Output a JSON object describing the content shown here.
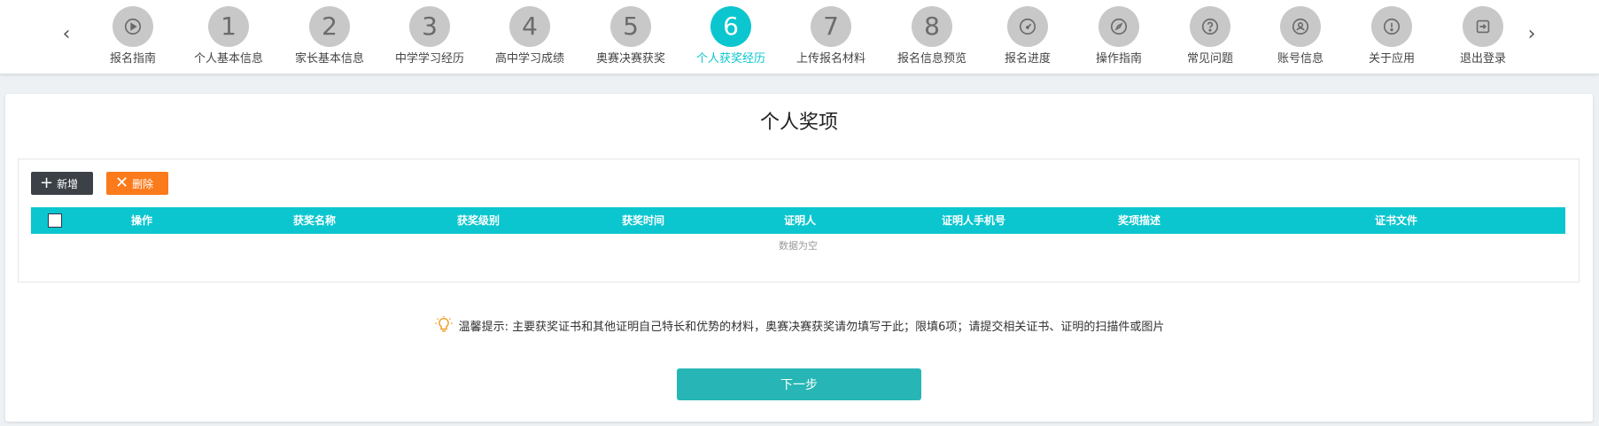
{
  "nav": {
    "prev_arrow": "‹",
    "next_arrow": "›",
    "steps": [
      {
        "label": "报名指南",
        "icon": "play-circle-icon"
      },
      {
        "label": "个人基本信息",
        "num": "1"
      },
      {
        "label": "家长基本信息",
        "num": "2"
      },
      {
        "label": "中学学习经历",
        "num": "3"
      },
      {
        "label": "高中学习成绩",
        "num": "4"
      },
      {
        "label": "奥赛决赛获奖",
        "num": "5"
      },
      {
        "label": "个人获奖经历",
        "num": "6",
        "active": true
      },
      {
        "label": "上传报名材料",
        "num": "7"
      },
      {
        "label": "报名信息预览",
        "num": "8"
      },
      {
        "label": "报名进度",
        "icon": "gauge-icon"
      },
      {
        "label": "操作指南",
        "icon": "compass-icon"
      },
      {
        "label": "常见问题",
        "icon": "question-circle-icon"
      },
      {
        "label": "账号信息",
        "icon": "user-settings-icon"
      },
      {
        "label": "关于应用",
        "icon": "info-circle-icon"
      },
      {
        "label": "退出登录",
        "icon": "logout-icon"
      }
    ]
  },
  "page": {
    "title": "个人奖项",
    "add_label": "新增",
    "delete_label": "删除",
    "columns": [
      "操作",
      "获奖名称",
      "获奖级别",
      "获奖时间",
      "证明人",
      "证明人手机号",
      "奖项描述",
      "证书文件"
    ],
    "empty_text": "数据为空",
    "tip": "温馨提示: 主要获奖证书和其他证明自己特长和优势的材料，奥赛决赛获奖请勿填写于此；限填6项；请提交相关证书、证明的扫描件或图片",
    "next_label": "下一步"
  },
  "colors": {
    "accent": "#0bc6cf",
    "next_button": "#27b6b5",
    "delete_button": "#fb7a1b",
    "add_button": "#3c4148"
  }
}
